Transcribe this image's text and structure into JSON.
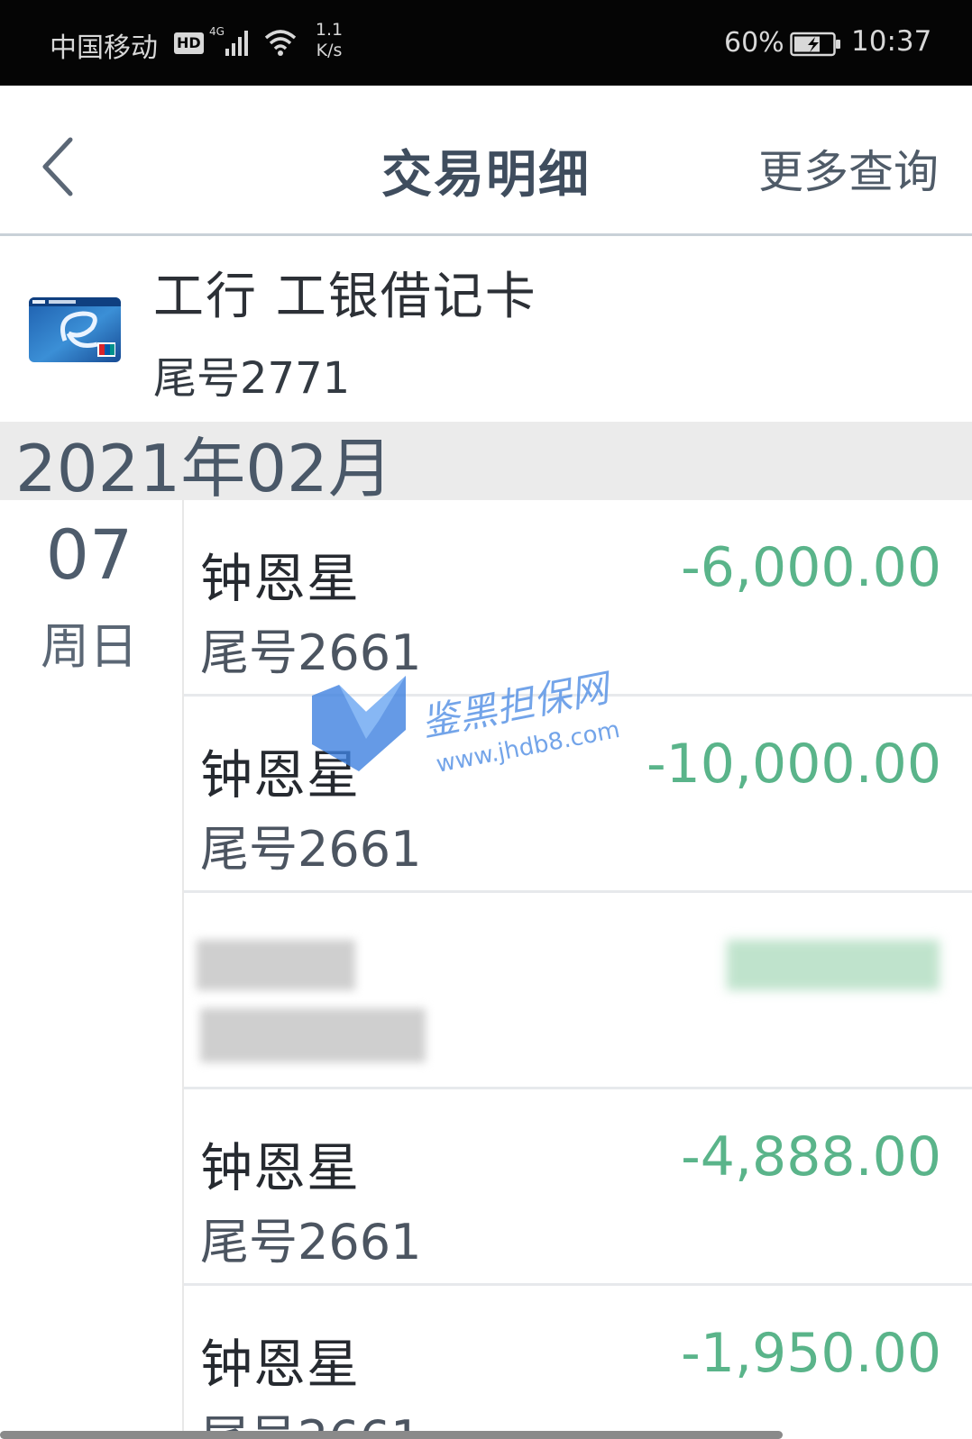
{
  "status_bar": {
    "carrier": "中国移动",
    "hd_badge": "HD",
    "network_speed_value": "1.1",
    "network_speed_unit": "K/s",
    "battery_percent": "60%",
    "time": "10:37"
  },
  "header": {
    "back_icon": "chevron-left-icon",
    "title": "交易明细",
    "more_query": "更多查询"
  },
  "card": {
    "name": "工行 工银借记卡",
    "tail": "尾号2771"
  },
  "month": "2021年02月",
  "date_group": {
    "day": "07",
    "weekday": "周日"
  },
  "transactions": [
    {
      "name": "钟恩星",
      "tail": "尾号2661",
      "amount": "-6,000.00"
    },
    {
      "name": "钟恩星",
      "tail": "尾号2661",
      "amount": "-10,000.00"
    },
    {
      "name": "",
      "tail": "",
      "amount": ""
    },
    {
      "name": "钟恩星",
      "tail": "尾号2661",
      "amount": "-4,888.00"
    },
    {
      "name": "钟恩星",
      "tail": "尾号2661",
      "amount": "-1,950.00"
    }
  ],
  "watermark": {
    "name": "鉴黑担保网",
    "url": "www.jhdb8.com"
  },
  "colors": {
    "amount_green": "#5ab48a",
    "title_gray": "#3f4d5e",
    "status_bar_bg": "#050505",
    "month_bar_bg": "#ebebeb"
  }
}
